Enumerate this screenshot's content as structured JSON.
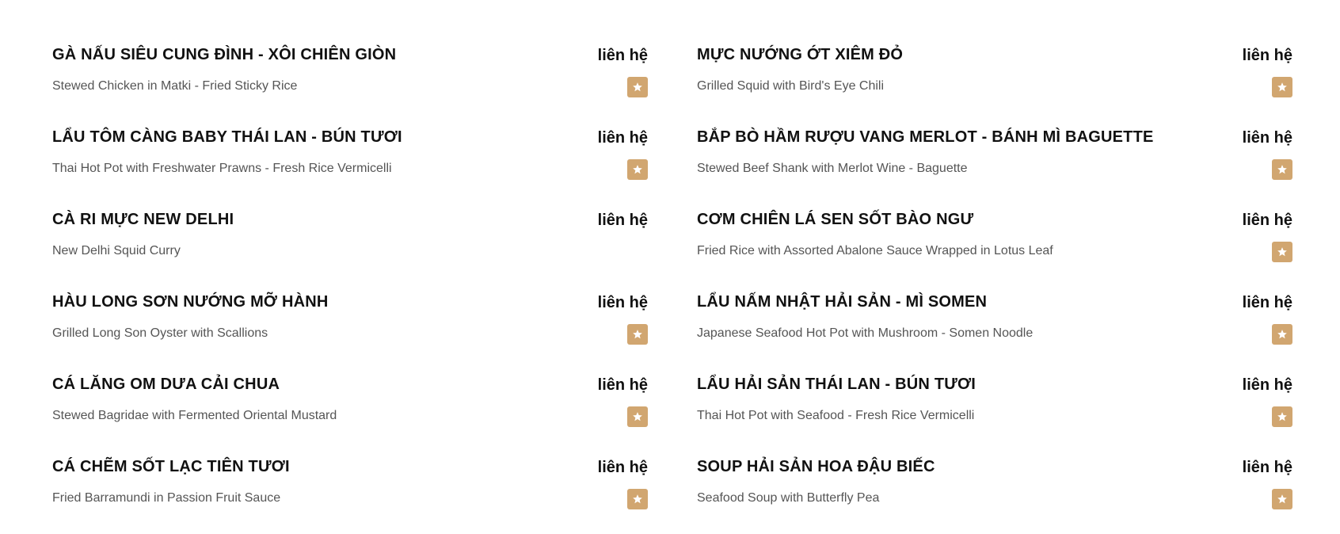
{
  "menu": {
    "left": [
      {
        "name": "GÀ NẤU SIÊU CUNG ĐÌNH - XÔI CHIÊN GIÒN",
        "price": "liên hệ",
        "desc": "Stewed Chicken in Matki - Fried Sticky Rice",
        "icon": "star-icon",
        "featured": true
      },
      {
        "name": "LẨU TÔM CÀNG BABY THÁI LAN - BÚN TƯƠI",
        "price": "liên hệ",
        "desc": "Thai Hot Pot with Freshwater Prawns - Fresh Rice Vermicelli",
        "icon": "star-icon",
        "featured": true
      },
      {
        "name": "CÀ RI MỰC NEW DELHI",
        "price": "liên hệ",
        "desc": "New Delhi Squid Curry",
        "icon": "star-icon",
        "featured": false
      },
      {
        "name": "HÀU LONG SƠN NƯỚNG MỠ HÀNH",
        "price": "liên hệ",
        "desc": "Grilled Long Son Oyster with Scallions",
        "icon": "star-icon",
        "featured": true
      },
      {
        "name": "CÁ LĂNG OM DƯA CẢI CHUA",
        "price": "liên hệ",
        "desc": "Stewed Bagridae with Fermented Oriental Mustard",
        "icon": "star-icon",
        "featured": true
      },
      {
        "name": "CÁ CHẼM SỐT LẠC TIÊN TƯƠI",
        "price": "liên hệ",
        "desc": "Fried Barramundi in Passion Fruit Sauce",
        "icon": "star-icon",
        "featured": true
      }
    ],
    "right": [
      {
        "name": "MỰC NƯỚNG ỚT XIÊM ĐỎ",
        "price": "liên hệ",
        "desc": "Grilled Squid with Bird's Eye Chili",
        "icon": "star-icon",
        "featured": true
      },
      {
        "name": "BẮP BÒ HẦM RƯỢU VANG MERLOT - BÁNH MÌ BAGUETTE",
        "price": "liên hệ",
        "desc": "Stewed Beef Shank with Merlot Wine - Baguette",
        "icon": "star-icon",
        "featured": true
      },
      {
        "name": "CƠM CHIÊN LÁ SEN SỐT BÀO NGƯ",
        "price": "liên hệ",
        "desc": "Fried Rice with Assorted Abalone Sauce Wrapped in Lotus Leaf",
        "icon": "star-icon",
        "featured": true
      },
      {
        "name": "LẨU NẤM NHẬT HẢI SẢN - MÌ SOMEN",
        "price": "liên hệ",
        "desc": "Japanese Seafood Hot Pot with Mushroom - Somen Noodle",
        "icon": "star-icon",
        "featured": true
      },
      {
        "name": "LẨU HẢI SẢN THÁI LAN - BÚN TƯƠI",
        "price": "liên hệ",
        "desc": "Thai Hot Pot with Seafood - Fresh Rice Vermicelli",
        "icon": "star-icon",
        "featured": true
      },
      {
        "name": "SOUP HẢI SẢN HOA ĐẬU BIẾC",
        "price": "liên hệ",
        "desc": "Seafood Soup with Butterfly Pea",
        "icon": "star-icon",
        "featured": true
      }
    ]
  },
  "colors": {
    "badge": "#d1a670",
    "title": "#111111",
    "description": "#555555"
  }
}
